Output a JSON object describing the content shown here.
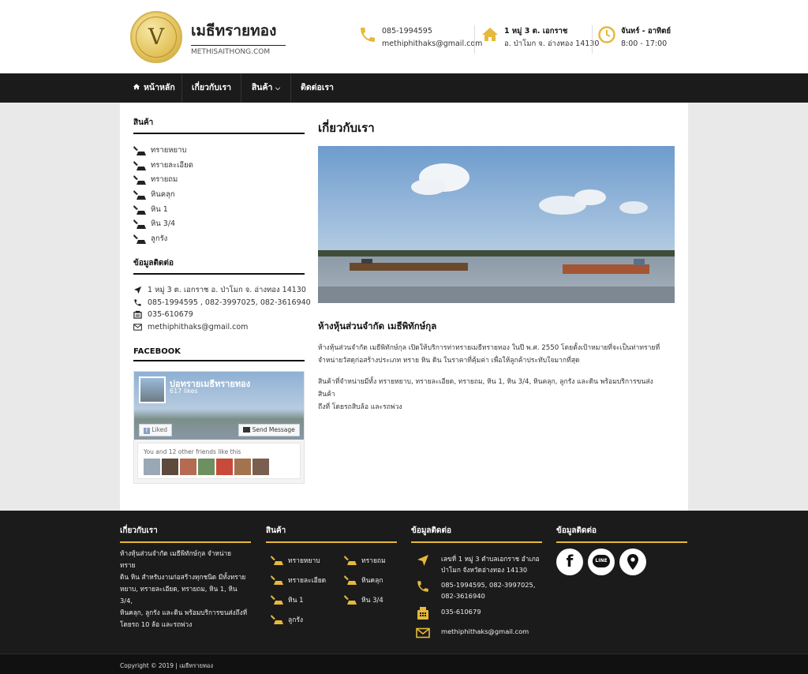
{
  "header": {
    "logo_letter": "V",
    "title": "เมธีทรายทอง",
    "subtitle": "METHISAITHONG.COM",
    "phone": "085-1994595",
    "email": "methiphithaks@gmail.com",
    "address_line1": "1 หมู่ 3 ต. เอกราช",
    "address_line2": "อ. ป่าโมก จ. อ่างทอง 14130",
    "hours_line1": "จันทร์ - อาทิตย์",
    "hours_line2": "8:00 - 17:00"
  },
  "nav": {
    "home": "หน้าหลัก",
    "about": "เกี่ยวกับเรา",
    "products": "สินค้า",
    "contact": "ติดต่อเรา"
  },
  "sidebar": {
    "products_heading": "สินค้า",
    "products": [
      "ทรายหยาบ",
      "ทรายละเอียด",
      "ทรายถม",
      "หินคลุก",
      "หิน 1",
      "หิน 3/4",
      "ลูกรัง"
    ],
    "contact_heading": "ข้อมูลติดต่อ",
    "contact": {
      "address": "1 หมู่ 3 ต. เอกราช อ. ป่าโมก จ. อ่างทอง 14130",
      "phones": "085-1994595 , 082-3997025, 082-3616940",
      "fax": "035-610679",
      "email": "methiphithaks@gmail.com"
    },
    "facebook_heading": "FACEBOOK",
    "facebook": {
      "page_name": "บ่อทรายเมธีทรายทอง",
      "likes": "617 likes",
      "liked": "Liked",
      "send": "Send Message",
      "friends_text": "You and 12 other friends like this"
    }
  },
  "content": {
    "title": "เกี่ยวกับเรา",
    "subtitle": "ห้างหุ้นส่วนจำกัด เมธีพิทักษ์กุล",
    "para1_line1": "ห้างหุ้นส่วนจำกัด เมธีพิทักษ์กุล เปิดให้บริการท่าทรายเมธีทรายทอง ในปี พ.ศ. 2550 โดยตั้งเป้าหมายที่จะเป็นท่าทรายที่",
    "para1_line2": "จำหน่ายวัสดุก่อสร้างประเภท ทราย หิน ดิน ในราคาที่คุ้มค่า เพื่อให้ลูกค้าประทับใจมากที่สุด",
    "para2_line1": "สินค้าที่จำหน่ายมีทั้ง ทรายหยาบ, ทรายละเอียด, ทรายถม, หิน 1, หิน 3/4, หินคลุก, ลูกรัง และดิน พร้อมบริการขนส่งสินค้า",
    "para2_line2": "ถึงที่ โดยรถสิบล้อ และรถพ่วง"
  },
  "footer": {
    "about_heading": "เกี่ยวกับเรา",
    "about_lines": [
      "ห้างหุ้นส่วนจำกัด เมธีพิทักษ์กุล จำหน่าย ทราย",
      "ดิน หิน สำหรับงานก่อสร้างทุกชนิด มีทั้งทราย",
      "หยาบ, ทรายละเอียด, ทรายถม, หิน 1, หิน 3/4,",
      "หินคลุก, ลูกรัง และดิน พร้อมบริการขนส่งถึงที่",
      "โดยรถ 10 ล้อ และรถพ่วง"
    ],
    "products_heading": "สินค้า",
    "products_col1": [
      "ทรายหยาบ",
      "ทรายละเอียด",
      "หิน 1",
      "ลูกรัง"
    ],
    "products_col2": [
      "ทรายถม",
      "หินคลุก",
      "หิน 3/4"
    ],
    "contact_heading": "ข้อมูลติดต่อ",
    "contact_address1": "เลขที่ 1 หมู่ 3 ตำบลเอกราช อำเภอ",
    "contact_address2": "ป่าโมก จังหวัดอ่างทอง 14130",
    "contact_phone1": "085-1994595, 082-3997025,",
    "contact_phone2": "082-3616940",
    "contact_fax": "035-610679",
    "contact_email": "methiphithaks@gmail.com",
    "social_heading": "ข้อมูลติดต่อ",
    "line_label": "LINE",
    "copyright": "Copyright © 2019 | เมธีทรายทอง"
  },
  "colors": {
    "accent": "#e5b93b",
    "nav_bg": "#1b1b1b",
    "footer_bg": "#1b1b1b"
  }
}
